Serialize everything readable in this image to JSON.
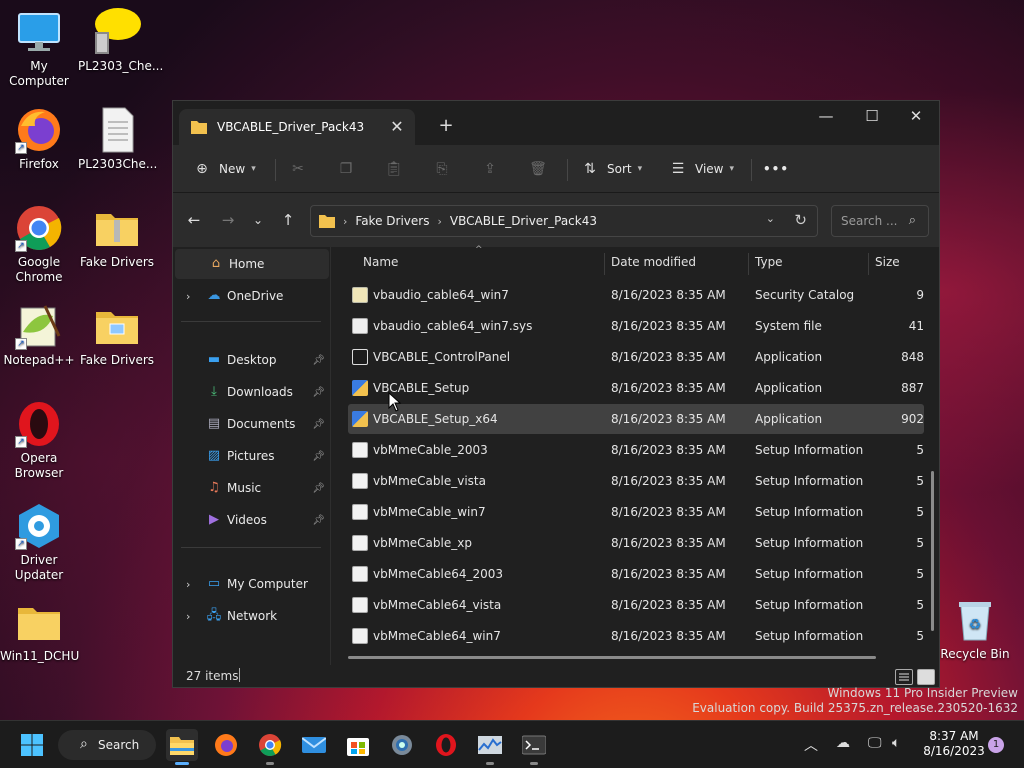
{
  "desktop": {
    "icons": [
      {
        "label": "My Computer",
        "icon": "monitor-icon"
      },
      {
        "label": "PL2303_Che...",
        "icon": "archive-icon"
      },
      {
        "label": "Firefox",
        "icon": "firefox-icon"
      },
      {
        "label": "PL2303Che...",
        "icon": "text-document-icon"
      },
      {
        "label": "Google Chrome",
        "icon": "chrome-icon"
      },
      {
        "label": "Fake Drivers",
        "icon": "zipped-folder-icon"
      },
      {
        "label": "Notepad++",
        "icon": "notepadpp-icon"
      },
      {
        "label": "Fake Drivers",
        "icon": "folder-icon"
      },
      {
        "label": "Opera Browser",
        "icon": "opera-icon"
      },
      {
        "label": "Driver Updater",
        "icon": "driver-updater-icon"
      },
      {
        "label": "Win11_DCHU",
        "icon": "folder-icon"
      },
      {
        "label": "Recycle Bin",
        "icon": "recycle-bin-icon"
      }
    ],
    "watermark": {
      "line1": "Windows 11 Pro Insider Preview",
      "line2": "Evaluation copy. Build 25375.zn_release.230520-1632"
    }
  },
  "explorer": {
    "tab_title": "VBCABLE_Driver_Pack43",
    "window_controls": {
      "minimize": "—",
      "maximize": "☐",
      "close": "✕"
    },
    "toolbar": {
      "new_label": "New",
      "sort_label": "Sort",
      "view_label": "View",
      "more_label": "•••"
    },
    "breadcrumb": [
      "Fake Drivers",
      "VBCABLE_Driver_Pack43"
    ],
    "search_placeholder": "Search ...",
    "sidebar": {
      "home": "Home",
      "onedrive": "OneDrive",
      "quick": [
        "Desktop",
        "Downloads",
        "Documents",
        "Pictures",
        "Music",
        "Videos"
      ],
      "mycomputer": "My Computer",
      "network": "Network"
    },
    "columns": {
      "name": "Name",
      "date": "Date modified",
      "type": "Type",
      "size": "Size"
    },
    "files": [
      {
        "name": "vbaudio_cable64_win7",
        "date": "8/16/2023 8:35 AM",
        "type": "Security Catalog",
        "size": "9",
        "icon": "catalog-icon"
      },
      {
        "name": "vbaudio_cable64_win7.sys",
        "date": "8/16/2023 8:35 AM",
        "type": "System file",
        "size": "41",
        "icon": "sys-file-icon"
      },
      {
        "name": "VBCABLE_ControlPanel",
        "date": "8/16/2023 8:35 AM",
        "type": "Application",
        "size": "848",
        "icon": "vb-app-icon"
      },
      {
        "name": "VBCABLE_Setup",
        "date": "8/16/2023 8:35 AM",
        "type": "Application",
        "size": "887",
        "icon": "setup-app-icon"
      },
      {
        "name": "VBCABLE_Setup_x64",
        "date": "8/16/2023 8:35 AM",
        "type": "Application",
        "size": "902",
        "icon": "setup-app-icon",
        "selected": true
      },
      {
        "name": "vbMmeCable_2003",
        "date": "8/16/2023 8:35 AM",
        "type": "Setup Information",
        "size": "5",
        "icon": "inf-file-icon"
      },
      {
        "name": "vbMmeCable_vista",
        "date": "8/16/2023 8:35 AM",
        "type": "Setup Information",
        "size": "5",
        "icon": "inf-file-icon"
      },
      {
        "name": "vbMmeCable_win7",
        "date": "8/16/2023 8:35 AM",
        "type": "Setup Information",
        "size": "5",
        "icon": "inf-file-icon"
      },
      {
        "name": "vbMmeCable_xp",
        "date": "8/16/2023 8:35 AM",
        "type": "Setup Information",
        "size": "5",
        "icon": "inf-file-icon"
      },
      {
        "name": "vbMmeCable64_2003",
        "date": "8/16/2023 8:35 AM",
        "type": "Setup Information",
        "size": "5",
        "icon": "inf-file-icon"
      },
      {
        "name": "vbMmeCable64_vista",
        "date": "8/16/2023 8:35 AM",
        "type": "Setup Information",
        "size": "5",
        "icon": "inf-file-icon"
      },
      {
        "name": "vbMmeCable64_win7",
        "date": "8/16/2023 8:35 AM",
        "type": "Setup Information",
        "size": "5",
        "icon": "inf-file-icon"
      }
    ],
    "status": {
      "count": "27 items"
    }
  },
  "taskbar": {
    "search_label": "Search",
    "time": "8:37 AM",
    "date": "8/16/2023",
    "notifications": "1"
  },
  "colors": {
    "accent": "#5aaefc",
    "window_bg": "#202020",
    "toolbar_bg": "#2c2c2c",
    "selection": "#414141"
  }
}
